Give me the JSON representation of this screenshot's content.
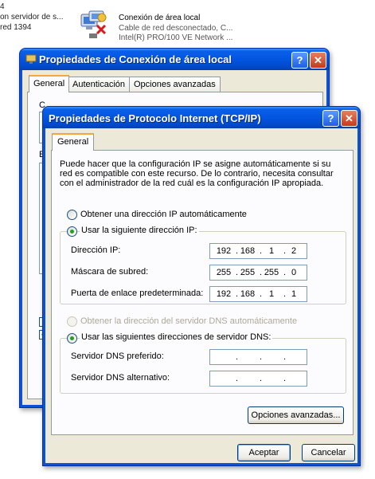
{
  "background": {
    "left_lines": [
      "4",
      "on servidor de s...",
      "red 1394"
    ],
    "connection": {
      "name": "Conexión de área local",
      "status": "Cable de red desconectado, C...",
      "adapter": "Intel(R) PRO/100 VE Network ..."
    }
  },
  "outer_window": {
    "title": "Propiedades de Conexión de área local",
    "tabs": [
      "General",
      "Autenticación",
      "Opciones avanzadas"
    ],
    "partial_label_c": "C",
    "partial_label_e": "E"
  },
  "dialog": {
    "title": "Propiedades de Protocolo Internet (TCP/IP)",
    "help_label": "?",
    "close_label": "✕",
    "tab": "General",
    "description": "Puede hacer que la configuración IP se asigne automáticamente si su red es compatible con este recurso. De lo contrario, necesita consultar con el administrador de la red cuál es la configuración IP apropiada.",
    "ip_auto_label": "Obtener una dirección IP automáticamente",
    "ip_manual_label": "Usar la siguiente dirección IP:",
    "ip_mode": "manual",
    "fields": {
      "ip_label": "Dirección IP:",
      "ip": [
        "192",
        "168",
        "1",
        "2"
      ],
      "mask_label": "Máscara de subred:",
      "mask": [
        "255",
        "255",
        "255",
        "0"
      ],
      "gateway_label": "Puerta de enlace predeterminada:",
      "gateway": [
        "192",
        "168",
        "1",
        "1"
      ]
    },
    "dns_auto_label": "Obtener la dirección del servidor DNS automáticamente",
    "dns_manual_label": "Usar las siguientes direcciones de servidor DNS:",
    "dns_mode": "manual",
    "dns_preferred_label": "Servidor DNS preferido:",
    "dns_alternate_label": "Servidor DNS alternativo:",
    "advanced_button": "Opciones avanzadas...",
    "ok_button": "Aceptar",
    "cancel_button": "Cancelar"
  },
  "colors": {
    "titlebar": "#0355e0",
    "dialog_face": "#ece9d8",
    "active_tab_accent": "#f5a83a",
    "radio_dot": "#21a121"
  }
}
